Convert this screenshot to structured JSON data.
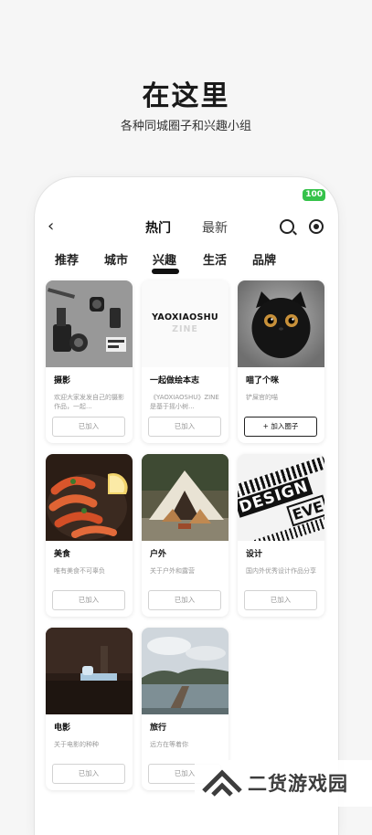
{
  "promo": {
    "title": "在这里",
    "subtitle": "各种同城圈子和兴趣小组"
  },
  "status": {
    "battery": "100"
  },
  "topbar": {
    "back_icon": "chevron-left-icon",
    "tabs": [
      "热门",
      "最新"
    ],
    "search_icon": "search-icon",
    "radar_icon": "radar-icon"
  },
  "categories": {
    "items": [
      "推荐",
      "城市",
      "兴趣",
      "生活",
      "品牌"
    ],
    "active": "兴趣"
  },
  "cards": [
    {
      "name": "摄影",
      "desc": "欢迎大家发发自己的摄影作品，一起...",
      "button": "已加入",
      "image_text": ""
    },
    {
      "name": "一起做绘本志",
      "desc": "《YAOXIAOSHU》ZINE是基于摇小树...",
      "button": "已加入",
      "image_text": "YAOXIAOSHU",
      "image_text2": "ZINE"
    },
    {
      "name": "喵了个咪",
      "desc": "铲屎官的喵",
      "button": "+ 加入圈子",
      "image_text": ""
    },
    {
      "name": "美食",
      "desc": "唯有美食不可辜负",
      "button": "已加入",
      "image_text": ""
    },
    {
      "name": "户外",
      "desc": "关于户外和露营",
      "button": "已加入",
      "image_text": ""
    },
    {
      "name": "设计",
      "desc": "国内外优秀设计作品分享",
      "button": "已加入",
      "image_text": "DESIGN",
      "image_text2": "EVE"
    },
    {
      "name": "电影",
      "desc": "关于电影的种种",
      "button": "已加入",
      "image_text": ""
    },
    {
      "name": "旅行",
      "desc": "远方在等着你",
      "button": "已加入",
      "image_text": ""
    }
  ],
  "watermark": {
    "text": "二货游戏园"
  },
  "colors": {
    "accent": "#111111",
    "battery": "#35c24a",
    "muted": "#999999"
  }
}
